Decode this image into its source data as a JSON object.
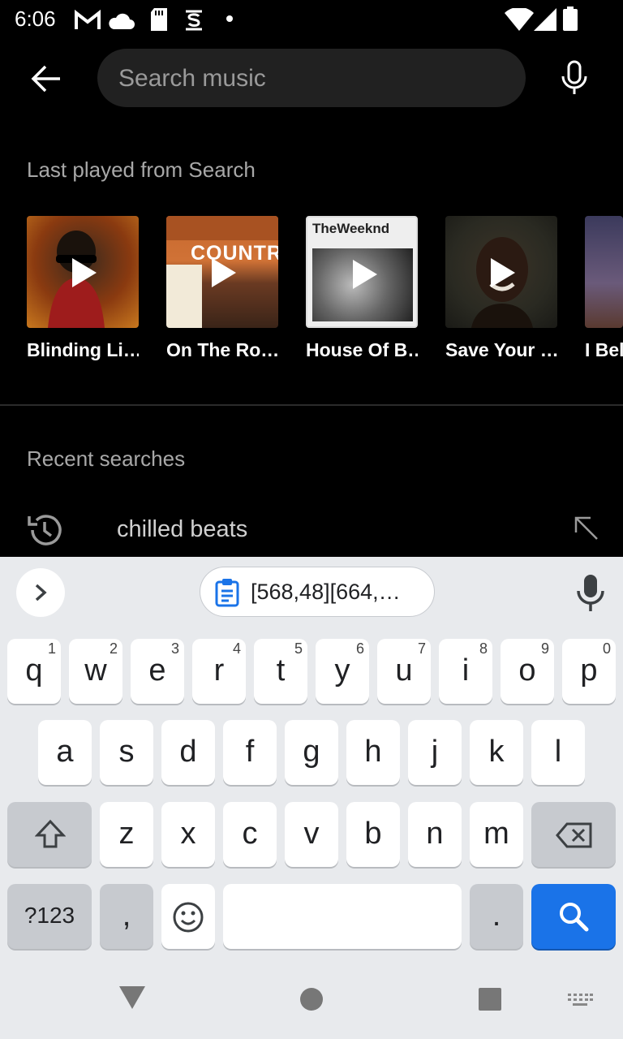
{
  "status_bar": {
    "time": "6:06",
    "icons": [
      "gmail-icon",
      "cloud-icon",
      "sd-card-icon",
      "s-icon",
      "dot-icon",
      "wifi-icon",
      "signal-icon",
      "battery-icon"
    ]
  },
  "search": {
    "placeholder": "Search music"
  },
  "last_played": {
    "title": "Last played from Search",
    "items": [
      {
        "label": "Blinding Li…",
        "art_text": ""
      },
      {
        "label": "On The Ro…",
        "art_text": "COUNTRY"
      },
      {
        "label": "House Of B…",
        "art_text": "TheWeeknd"
      },
      {
        "label": "Save Your …",
        "art_text": ""
      },
      {
        "label": "I Bel",
        "art_text": ""
      }
    ]
  },
  "recent_searches": {
    "title": "Recent searches",
    "items": [
      {
        "text": "chilled beats"
      }
    ]
  },
  "keyboard": {
    "clipboard_text": "[568,48][664,…",
    "row1": [
      {
        "k": "q",
        "h": "1"
      },
      {
        "k": "w",
        "h": "2"
      },
      {
        "k": "e",
        "h": "3"
      },
      {
        "k": "r",
        "h": "4"
      },
      {
        "k": "t",
        "h": "5"
      },
      {
        "k": "y",
        "h": "6"
      },
      {
        "k": "u",
        "h": "7"
      },
      {
        "k": "i",
        "h": "8"
      },
      {
        "k": "o",
        "h": "9"
      },
      {
        "k": "p",
        "h": "0"
      }
    ],
    "row2": [
      "a",
      "s",
      "d",
      "f",
      "g",
      "h",
      "j",
      "k",
      "l"
    ],
    "row3": [
      "z",
      "x",
      "c",
      "v",
      "b",
      "n",
      "m"
    ],
    "symbols_label": "?123",
    "comma": ",",
    "period": ".",
    "accent_color": "#1a73e8"
  }
}
